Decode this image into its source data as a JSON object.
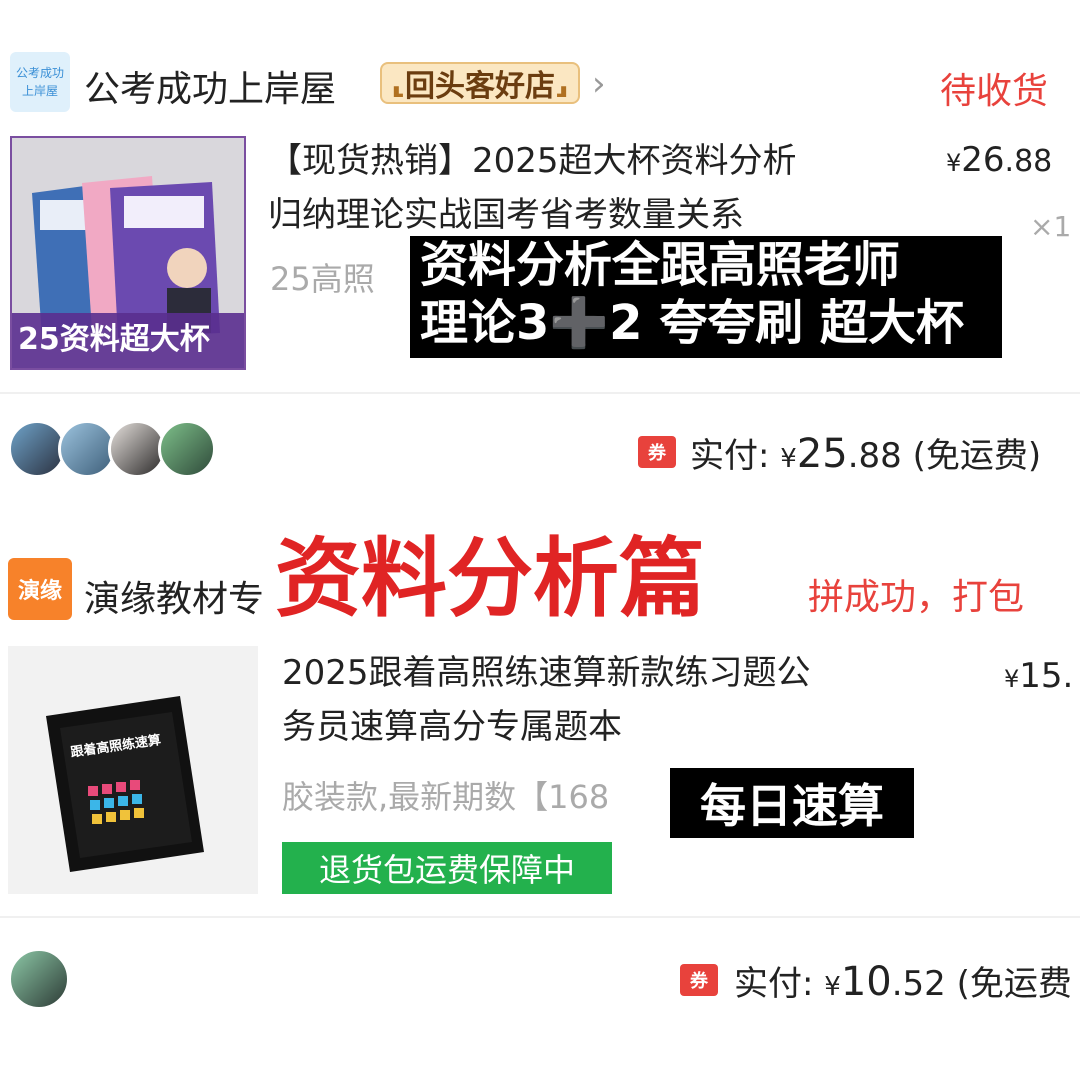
{
  "order1": {
    "shop_logo_text": [
      "公考成功",
      "上岸屋"
    ],
    "shop_name": "公考成功上岸屋",
    "shop_badge": "回头客好店",
    "status": "待收货",
    "product_cover_text": "25资料超大杯",
    "title_line1": "【现货热销】2025超大杯资料分析",
    "title_line2": "归纳理论实战国考省考数量关系",
    "sku": "25高照",
    "price_symbol": "¥",
    "price_int": "26",
    "price_dec": ".88",
    "quantity": "×1",
    "overlay_line1": "资料分析全跟高照老师",
    "overlay_line2": "理论3➕2 夸夸刷 超大杯",
    "coupon_label": "券",
    "paid_label": "实付:",
    "paid_symbol": "¥",
    "paid_int": "25",
    "paid_dec": ".88",
    "shipping_note": "(免运费)"
  },
  "banner_title": "资料分析篇",
  "order2": {
    "shop_logo_text": "演缘",
    "shop_name": "演缘教材专",
    "status": "拼成功，打包",
    "book_cover_text": "跟着高照练速算",
    "title_line1": "2025跟着高照练速算新款练习题公",
    "title_line2": "务员速算高分专属题本",
    "sku": "胶装款,最新期数【168",
    "overlay": "每日速算",
    "return_tag": "退货包运费保障中",
    "price_symbol": "¥",
    "price_int": "15.",
    "coupon_label": "券",
    "paid_label": "实付:",
    "paid_symbol": "¥",
    "paid_int": "10",
    "paid_dec": ".52",
    "shipping_note": "(免运费"
  },
  "colors": {
    "accent_red": "#e8423c",
    "green": "#23b14d",
    "badge_bg": "#fbe7c2",
    "logo_orange": "#f7822a"
  }
}
